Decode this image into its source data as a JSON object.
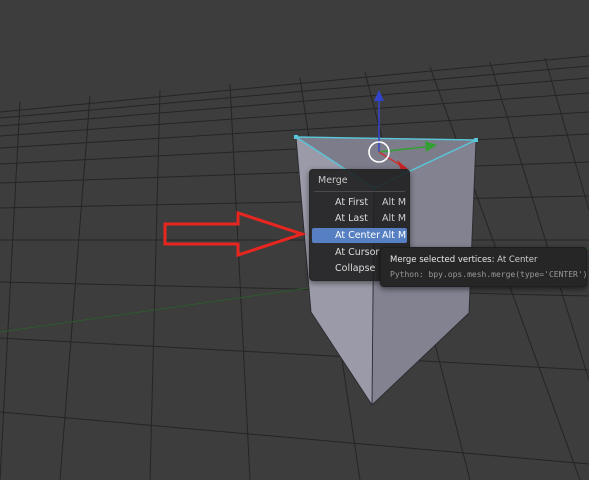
{
  "colors": {
    "viewport_background": "#3d3d3d",
    "grid_line": "#252525",
    "x_axis": "#8a3b3b",
    "y_axis": "#5b8a33",
    "mesh_face": "#8c8c9a",
    "selected_edge": "#59c7d9",
    "menu_highlight": "#5680c2",
    "annotation_arrow": "#e8261f"
  },
  "merge_menu": {
    "title": "Merge",
    "items": [
      {
        "label": "At First",
        "shortcut": "Alt M"
      },
      {
        "label": "At Last",
        "shortcut": "Alt M"
      },
      {
        "label": "At Center",
        "shortcut": "Alt M",
        "highlighted": true
      },
      {
        "label": "At Cursor",
        "shortcut": ""
      },
      {
        "label": "Collapse",
        "shortcut": ""
      }
    ]
  },
  "tooltip": {
    "title": "Merge selected vertices:",
    "value": "At Center",
    "python": "Python: bpy.ops.mesh.merge(type='CENTER')"
  },
  "icons": {
    "gizmo_z": "blue-arrow-up-icon",
    "gizmo_y": "green-arrow-right-icon",
    "gizmo_x": "red-arrow-icon",
    "pivot": "white-circle-icon",
    "annotation": "red-outline-arrow-icon"
  }
}
